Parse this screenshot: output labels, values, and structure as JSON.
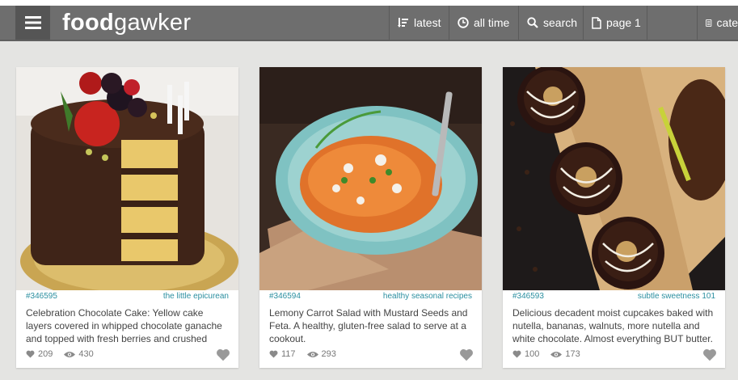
{
  "header": {
    "logo_bold": "food",
    "logo_light": "gawker",
    "nav": {
      "latest": "latest",
      "all_time": "all time",
      "search": "search",
      "page": "page 1",
      "categories": "cate"
    }
  },
  "cards": [
    {
      "id": "#346595",
      "source": "the little epicurean",
      "description": "Celebration Chocolate Cake: Yellow cake layers covered in whipped chocolate ganache and topped with fresh berries and crushed",
      "likes": "209",
      "views": "430"
    },
    {
      "id": "#346594",
      "source": "healthy seasonal recipes",
      "description": "Lemony Carrot Salad with Mustard Seeds and Feta. A healthy, gluten-free salad to serve at a cookout.",
      "likes": "117",
      "views": "293"
    },
    {
      "id": "#346593",
      "source": "subtle sweetness 101",
      "description": "Delicious decadent moist cupcakes baked with nutella, bananas, walnuts, more nutella and white chocolate. Almost everything BUT butter.",
      "likes": "100",
      "views": "173"
    }
  ],
  "colors": {
    "navbar": "#6e6e6e",
    "accent": "#2b8fa0",
    "background": "#e4e4e2"
  }
}
